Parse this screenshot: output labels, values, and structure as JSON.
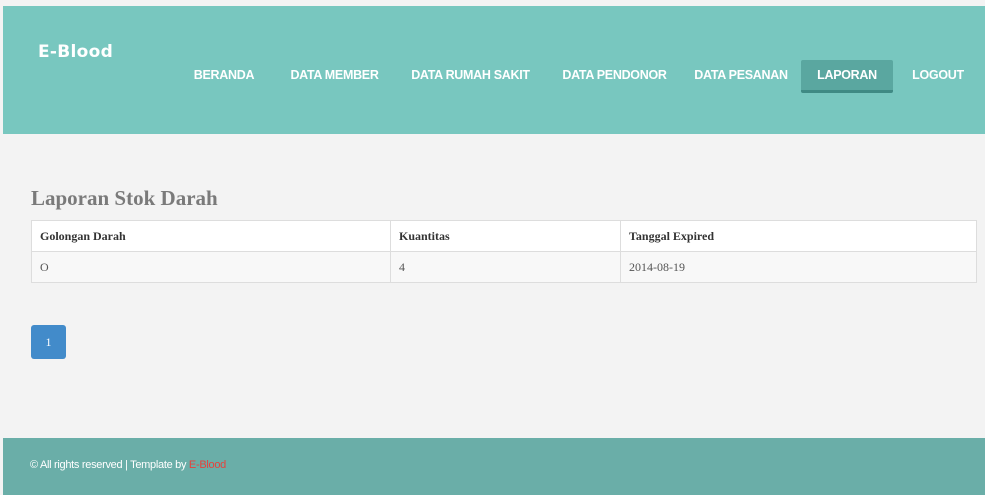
{
  "header": {
    "brand": "E-Blood",
    "nav": [
      {
        "label": "BERANDA"
      },
      {
        "label": "DATA MEMBER"
      },
      {
        "label": "DATA RUMAH SAKIT"
      },
      {
        "label": "DATA PENDONOR"
      },
      {
        "label": "DATA PESANAN"
      },
      {
        "label": "LAPORAN",
        "active": true
      },
      {
        "label": "LOGOUT"
      }
    ]
  },
  "main": {
    "title": "Laporan Stok Darah",
    "table": {
      "columns": [
        "Golongan Darah",
        "Kuantitas",
        "Tanggal Expired"
      ],
      "rows": [
        [
          "O",
          "4",
          "2014-08-19"
        ]
      ]
    },
    "pagination": {
      "current_page": "1"
    }
  },
  "footer": {
    "text": "© All rights reserved | Template by ",
    "link": "E-Blood"
  },
  "colors": {
    "header_bg": "#78c7bf",
    "active_nav_bg": "#5aa7a0",
    "footer_bg": "#6aaea8",
    "pagination_bg": "#428bca",
    "footer_link": "#e8413c"
  }
}
